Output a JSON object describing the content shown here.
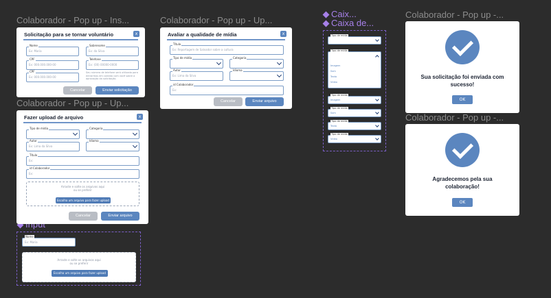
{
  "frames": {
    "f1": "Colaborador - Pop up - Ins...",
    "f2": "Colaborador - Pop up - Up...",
    "f3": "Colaborador - Pop up - Up...",
    "f4": "Colaborador - Pop up -...",
    "f5": "Colaborador - Pop up -..."
  },
  "components": {
    "caixa1": "Caix...",
    "caixa2": "Caixa de...",
    "input": "Input"
  },
  "volunteer": {
    "title": "Solicitação para se tornar voluntário",
    "close": "x",
    "fields": [
      {
        "label": "Nome",
        "placeholder": "Ex: Maria"
      },
      {
        "label": "Sobrenome",
        "placeholder": "Ex: da Silva"
      },
      {
        "label": "CPF",
        "placeholder": "Ex: 000.000.000-00"
      },
      {
        "label": "Telefone",
        "placeholder": "Ex: (00) 00000-0000"
      },
      {
        "label": "CPF",
        "placeholder": "Ex: 000.000.000-00"
      }
    ],
    "note": "Seu número de telefone será utilizado para entrarmos em contato com você sobre a aprovação da solicitação.",
    "cancel": "Cancelar",
    "submit": "Enviar solicitação"
  },
  "rate": {
    "title": "Avaliar a qualidade de mídia",
    "close": "x",
    "title_field": {
      "label": "Título",
      "placeholder": "Ex: Reportagem de Salvador sobre a cultura"
    },
    "type_field": {
      "label": "Tipo de mídia"
    },
    "category_field": {
      "label": "Categoria"
    },
    "author_field": {
      "label": "Autor",
      "placeholder": "Ex: Lima da Silva"
    },
    "language_field": {
      "label": "Idioma"
    },
    "collaborator_field": {
      "label": "id Colaborador",
      "placeholder": "Ex:"
    },
    "cancel": "Cancelar",
    "submit": "Enviar arquivo"
  },
  "upload_modal": {
    "title": "Fazer upload de arquivo",
    "close": "x",
    "type_field": {
      "label": "Tipo de mídia"
    },
    "category_field": {
      "label": "Categoria"
    },
    "author_field": {
      "label": "Autor",
      "placeholder": "Ex: Lima da Silva"
    },
    "language_field": {
      "label": "Idioma"
    },
    "title_field": {
      "label": "Título",
      "placeholder": "Ex:"
    },
    "collaborator_field": {
      "label": "id Colaborador",
      "placeholder": "Ex:"
    },
    "drop_line1": "Arraste e solte os arquivos aqui",
    "drop_line2": "ou se preferir",
    "choose": "Escolha um arquivo para fazer upload",
    "cancel": "Cancelar",
    "submit": "Enviar arquivo"
  },
  "dropdowns": {
    "label": "Tipo de mídia",
    "options": [
      "Imagem",
      "Som",
      "Texto",
      "Vídeo"
    ],
    "values": [
      "Imagem",
      "Som",
      "Texto",
      "Vídeo"
    ]
  },
  "input_comp": {
    "label": "Nome",
    "placeholder": "Ex: Maria",
    "drop_line1": "Arraste e solte os arquivos aqui",
    "drop_line2": "ou se preferir",
    "choose": "Escolha um arquivo para fazer upload"
  },
  "success1": {
    "msg1": "Sua solicitação foi enviada com",
    "msg2": "sucesso!",
    "ok": "OK"
  },
  "success2": {
    "msg1": "Agradecemos pela sua",
    "msg2": "colaboração!",
    "ok": "OK"
  },
  "colors": {
    "background": "#2c2c2c",
    "accent": "#5b86bf",
    "component": "#a680e8"
  }
}
